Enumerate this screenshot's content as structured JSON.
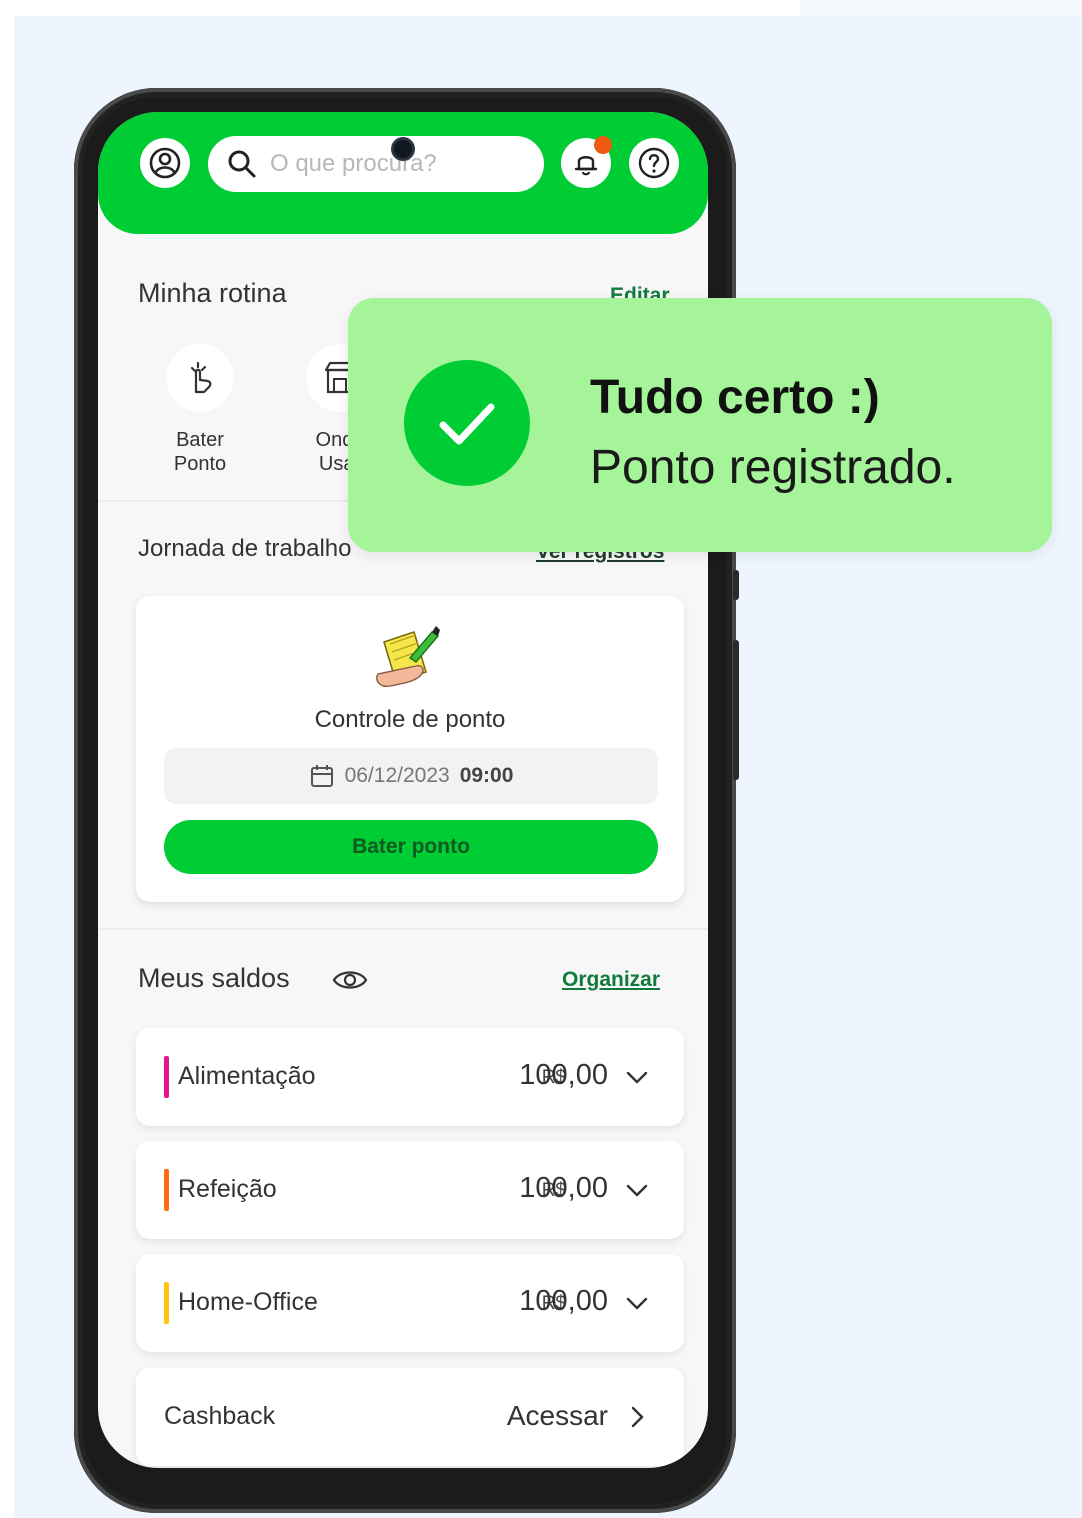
{
  "header": {
    "search_placeholder": "O que procura?"
  },
  "routine": {
    "title": "Minha rotina",
    "edit_label": "Editar",
    "items": [
      {
        "label_line1": "Bater",
        "label_line2": "Ponto",
        "icon": "hand-tap-icon"
      },
      {
        "label_line1": "Onde",
        "label_line2": "Usar",
        "icon": "store-icon"
      }
    ]
  },
  "workday": {
    "title": "Jornada de trabalho",
    "link_label": "Ver registros",
    "card": {
      "title": "Controle de ponto",
      "date": "06/12/2023",
      "time": "09:00",
      "button_label": "Bater ponto"
    }
  },
  "balances": {
    "title": "Meus saldos",
    "organize_label": "Organizar",
    "currency": "R$",
    "items": [
      {
        "name": "Alimentação",
        "amount": "100,00",
        "color": "#e0188f"
      },
      {
        "name": "Refeição",
        "amount": "100,00",
        "color": "#ff6a13"
      },
      {
        "name": "Home-Office",
        "amount": "100,00",
        "color": "#ffc20e"
      }
    ],
    "cashback": {
      "label": "Cashback",
      "action": "Acessar"
    }
  },
  "toast": {
    "title": "Tudo certo :)",
    "message": "Ponto registrado."
  },
  "colors": {
    "brand_green": "#00cc33",
    "toast_bg": "#a5f49a",
    "link_green": "#127a3c",
    "notification": "#ee5a12"
  }
}
